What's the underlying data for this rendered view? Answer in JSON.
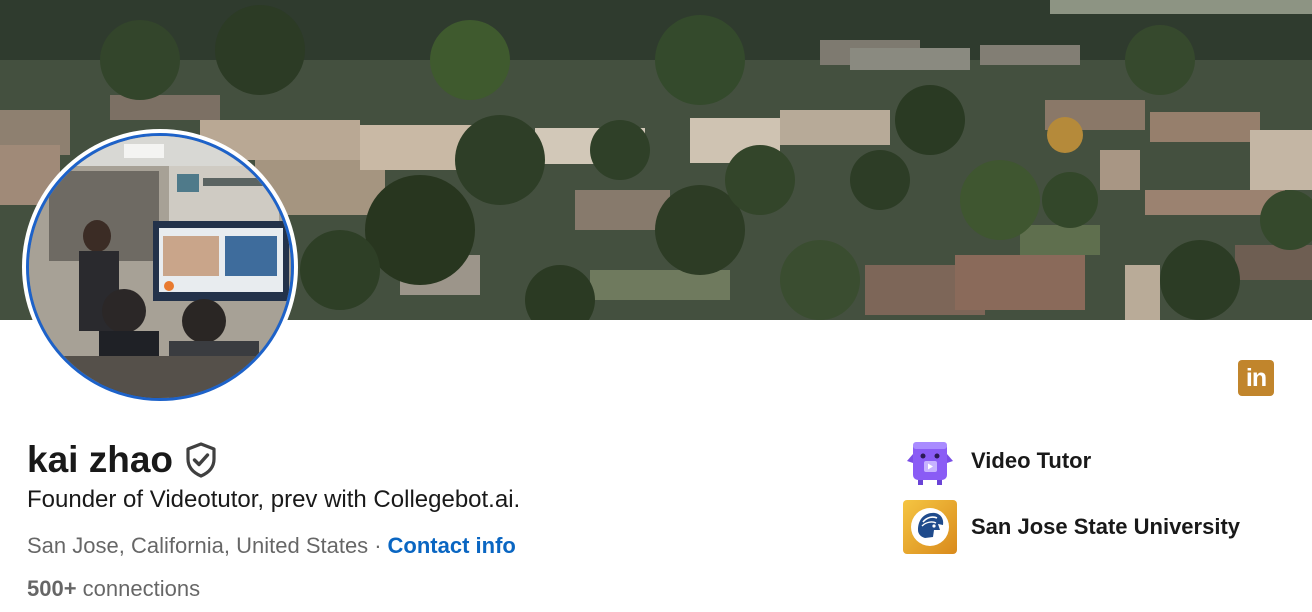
{
  "profile": {
    "name": "kai zhao",
    "headline": "Founder of Videotutor, prev with Collegebot.ai.",
    "location": "San Jose, California, United States",
    "separator": "·",
    "contact_label": "Contact info",
    "connections_count": "500+",
    "connections_label": " connections"
  },
  "badges": {
    "linkedin_icon_text": "in",
    "verified_icon": "verified-shield-icon"
  },
  "experience": [
    {
      "label": "Video Tutor",
      "icon": "video-tutor-logo"
    },
    {
      "label": "San Jose State University",
      "icon": "sjsu-spartan-logo"
    }
  ],
  "colors": {
    "link": "#0a66c2",
    "avatar_ring": "#1d62c9",
    "linkedin_badge": "#c1852c",
    "video_tutor_purple": "#8a5cf5",
    "sjsu_gold": "#e5a823"
  }
}
